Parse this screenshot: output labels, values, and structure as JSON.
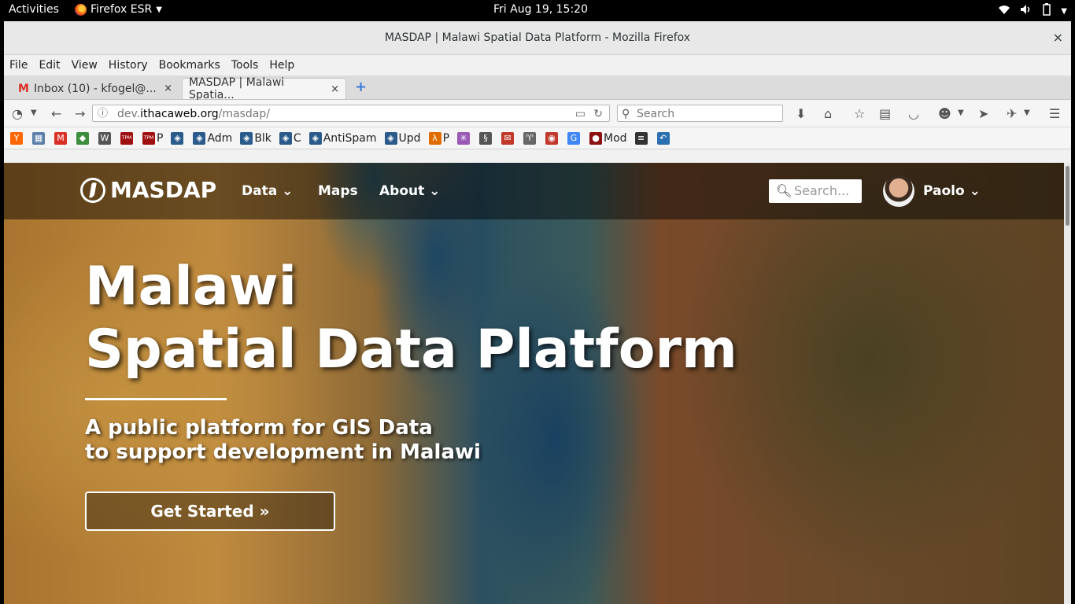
{
  "system": {
    "activities": "Activities",
    "app_name": "Firefox ESR",
    "clock": "Fri Aug 19, 15:20"
  },
  "window": {
    "title": "MASDAP | Malawi Spatial Data Platform - Mozilla Firefox",
    "close": "×"
  },
  "menu": [
    "File",
    "Edit",
    "View",
    "History",
    "Bookmarks",
    "Tools",
    "Help"
  ],
  "tabs": [
    {
      "label": "Inbox (10) - kfogel@...",
      "close": "×"
    },
    {
      "label": "MASDAP | Malawi Spatia...",
      "close": "×"
    }
  ],
  "newtab": "+",
  "urlbar": {
    "prefix": "dev.",
    "host": "ithacaweb.org",
    "path": "/masdap/"
  },
  "searchbar": {
    "placeholder": "Search"
  },
  "bookmarks": [
    {
      "label": "",
      "icon": "Y",
      "color": "#ff6600"
    },
    {
      "label": "",
      "icon": "▦",
      "color": "#5a7fa8"
    },
    {
      "label": "",
      "icon": "M",
      "color": "#d93025"
    },
    {
      "label": "",
      "icon": "◆",
      "color": "#3c8d3c"
    },
    {
      "label": "",
      "icon": "W",
      "color": "#555555"
    },
    {
      "label": "",
      "icon": "TPM",
      "color": "#a01010"
    },
    {
      "label": "P",
      "icon": "TPM",
      "color": "#a01010"
    },
    {
      "label": "",
      "icon": "◈",
      "color": "#2a5b8a"
    },
    {
      "label": "Adm",
      "icon": "◈",
      "color": "#2a5b8a"
    },
    {
      "label": "Blk",
      "icon": "◈",
      "color": "#2a5b8a"
    },
    {
      "label": "C",
      "icon": "◈",
      "color": "#2a5b8a"
    },
    {
      "label": "AntiSpam",
      "icon": "◈",
      "color": "#2a5b8a"
    },
    {
      "label": "Upd",
      "icon": "◈",
      "color": "#2a5b8a"
    },
    {
      "label": "P",
      "icon": "λ",
      "color": "#e06c00"
    },
    {
      "label": "",
      "icon": "✳",
      "color": "#9b59b6"
    },
    {
      "label": "",
      "icon": "§",
      "color": "#555555"
    },
    {
      "label": "",
      "icon": "✉",
      "color": "#c0392b"
    },
    {
      "label": "",
      "icon": "♈",
      "color": "#666666"
    },
    {
      "label": "",
      "icon": "◉",
      "color": "#c0392b"
    },
    {
      "label": "",
      "icon": "G",
      "color": "#4285f4"
    },
    {
      "label": "Mod",
      "icon": "●",
      "color": "#8b1010"
    },
    {
      "label": "",
      "icon": "≡",
      "color": "#333333"
    },
    {
      "label": "",
      "icon": "↶",
      "color": "#2a6fb0"
    }
  ],
  "site": {
    "logo": "MASDAP",
    "nav": [
      {
        "label": "Data",
        "caret": "⌄"
      },
      {
        "label": "Maps",
        "caret": ""
      },
      {
        "label": "About",
        "caret": "⌄"
      }
    ],
    "search_placeholder": "Search...",
    "user": "Paolo",
    "hero_title_1": "Malawi",
    "hero_title_2": "Spatial Data Platform",
    "hero_sub_1": "A public platform for GIS Data",
    "hero_sub_2": "to support development in Malawi",
    "cta": "Get Started »"
  }
}
